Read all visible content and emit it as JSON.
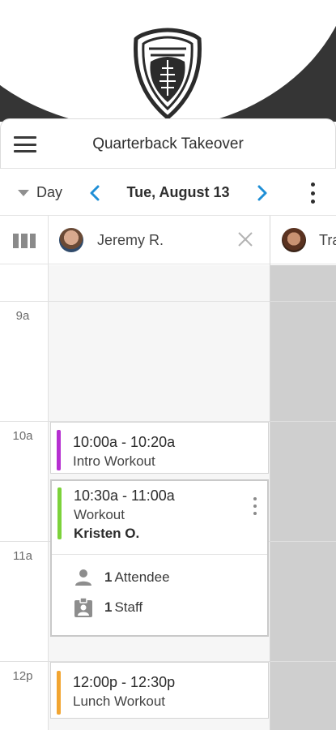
{
  "app": {
    "title": "Quarterback Takeover"
  },
  "toolbar": {
    "view": "Day",
    "date": "Tue, August 13"
  },
  "staff": [
    {
      "name": "Jeremy R."
    },
    {
      "name": "Tra"
    }
  ],
  "hours": [
    "9a",
    "10a",
    "11a",
    "12p"
  ],
  "events": [
    {
      "time": "10:00a - 10:20a",
      "name": "Intro Workout",
      "color": "#b62fd1"
    },
    {
      "time": "10:30a - 11:00a",
      "name": "Workout",
      "person": "Kristen O.",
      "color": "#7cd23a",
      "attendees_count": "1",
      "attendees_label": "Attendee",
      "staff_count": "1",
      "staff_label": "Staff"
    },
    {
      "time": "12:00p - 12:30p",
      "name": "Lunch Workout",
      "color": "#f2a531"
    }
  ],
  "colors": {
    "header_dark": "#353535",
    "nav_accent": "#1f8fd6",
    "unavailable": "#cfcfcf"
  }
}
